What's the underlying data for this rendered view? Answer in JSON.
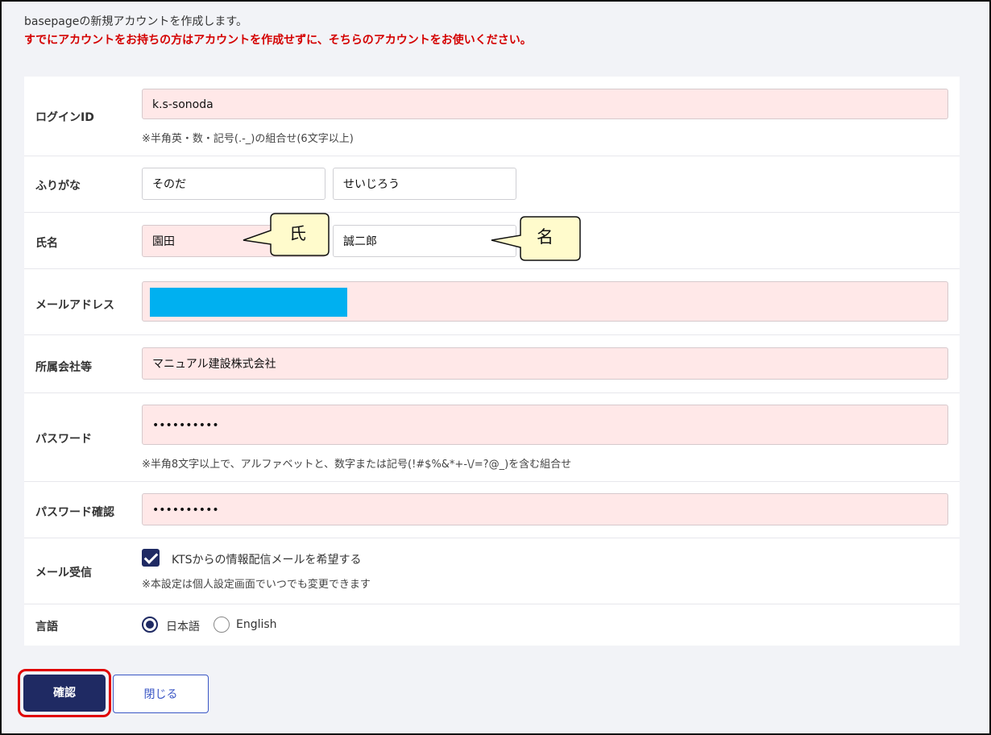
{
  "intro": {
    "text": "basepageの新規アカウントを作成します。",
    "warning": "すでにアカウントをお持ちの方はアカウントを作成せずに、そちらのアカウントをお使いください。"
  },
  "form": {
    "login_id": {
      "label": "ログインID",
      "value": "k.s-sonoda",
      "hint": "※半角英・数・記号(.-_)の組合せ(6文字以上)"
    },
    "furigana": {
      "label": "ふりがな",
      "last": "そのだ",
      "first": "せいじろう"
    },
    "name": {
      "label": "氏名",
      "last": "園田",
      "first": "誠二郎"
    },
    "email": {
      "label": "メールアドレス",
      "value": ""
    },
    "company": {
      "label": "所属会社等",
      "value": "マニュアル建設株式会社"
    },
    "password": {
      "label": "パスワード",
      "value": "••••••••••",
      "hint": "※半角8文字以上で、アルファベットと、数字または記号(!#$%&*+-\\/=?@_)を含む組合せ"
    },
    "password_confirm": {
      "label": "パスワード確認",
      "value": "••••••••••"
    },
    "mail": {
      "label": "メール受信",
      "checked": true,
      "checkbox_label": "KTSからの情報配信メールを希望する",
      "hint": "※本設定は個人設定画面でいつでも変更できます"
    },
    "language": {
      "label": "言語",
      "options": [
        "日本語",
        "English"
      ],
      "selected": "日本語"
    }
  },
  "buttons": {
    "confirm": "確認",
    "close": "閉じる"
  },
  "annotations": {
    "last_name": "氏",
    "first_name": "名"
  },
  "colors": {
    "accent": "#1f2a63",
    "warning": "#d40000",
    "field_required": "#ffe8e8",
    "mask": "#00b0f0",
    "highlight": "#e00000"
  }
}
